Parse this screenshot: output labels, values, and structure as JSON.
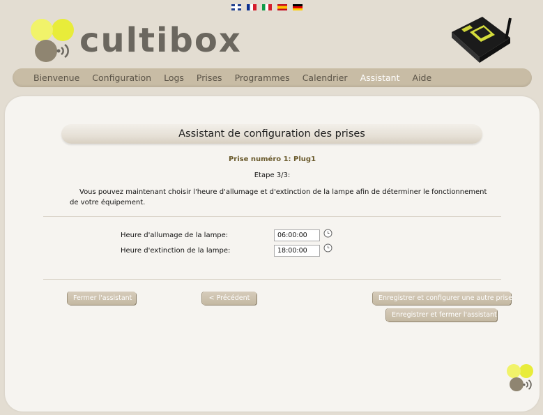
{
  "languages": [
    {
      "code": "en",
      "icon": "uk-flag-icon"
    },
    {
      "code": "fr",
      "icon": "france-flag-icon"
    },
    {
      "code": "it",
      "icon": "italy-flag-icon"
    },
    {
      "code": "es",
      "icon": "spain-flag-icon"
    },
    {
      "code": "de",
      "icon": "germany-flag-icon"
    }
  ],
  "brand": {
    "name": "cultibox",
    "accent": "#e8ec3a"
  },
  "nav": {
    "items": [
      {
        "label": "Bienvenue"
      },
      {
        "label": "Configuration"
      },
      {
        "label": "Logs"
      },
      {
        "label": "Prises"
      },
      {
        "label": "Programmes"
      },
      {
        "label": "Calendrier"
      },
      {
        "label": "Assistant",
        "active": true
      },
      {
        "label": "Aide"
      }
    ]
  },
  "wizard": {
    "title": "Assistant de configuration des prises",
    "plug_title": "Prise numéro 1: Plug1",
    "step": "Etape 3/3:",
    "description": "Vous pouvez maintenant choisir l'heure d'allumage et d'extinction de la lampe afin de déterminer le fonctionnement de votre équipement.",
    "on_label": "Heure d'allumage de la lampe:",
    "on_value": "06:00:00",
    "off_label": "Heure d'extinction de la lampe:",
    "off_value": "18:00:00"
  },
  "buttons": {
    "close": "Fermer l'assistant",
    "previous": "< Précédent",
    "save_next": "Enregistrer et configurer une autre prise",
    "save_close": "Enregistrer et fermer l'assistant"
  }
}
